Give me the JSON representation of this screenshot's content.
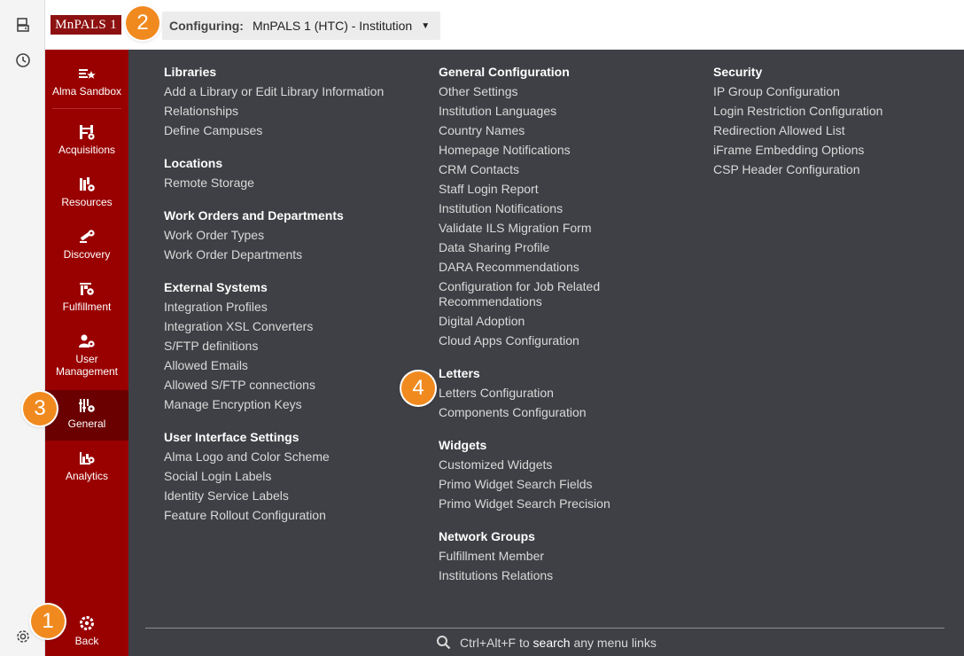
{
  "brand": {
    "logo_text": "MnPALS 1",
    "accent": "#990000",
    "logo_bg": "#8e1111"
  },
  "header": {
    "configuring_label": "Configuring:",
    "configuring_value": "MnPALS 1 (HTC) - Institution"
  },
  "rail": {
    "icons": [
      "server-icon",
      "history-icon",
      "settings-icon"
    ]
  },
  "badges": [
    "1",
    "2",
    "3",
    "4"
  ],
  "sidebar": {
    "items": [
      {
        "label": "Alma Sandbox",
        "icon": "sandbox-icon"
      },
      {
        "label": "Acquisitions",
        "icon": "acquisitions-icon"
      },
      {
        "label": "Resources",
        "icon": "resources-icon"
      },
      {
        "label": "Discovery",
        "icon": "discovery-icon"
      },
      {
        "label": "Fulfillment",
        "icon": "fulfillment-icon"
      },
      {
        "label": "User Management",
        "icon": "user-management-icon"
      },
      {
        "label": "General",
        "icon": "general-icon",
        "active": true
      },
      {
        "label": "Analytics",
        "icon": "analytics-icon"
      }
    ],
    "back_label": "Back"
  },
  "menu": {
    "col1": [
      {
        "heading": "Libraries",
        "links": [
          "Add a Library or Edit Library Information",
          "Relationships",
          "Define Campuses"
        ]
      },
      {
        "heading": "Locations",
        "links": [
          "Remote Storage"
        ]
      },
      {
        "heading": "Work Orders and Departments",
        "links": [
          "Work Order Types",
          "Work Order Departments"
        ]
      },
      {
        "heading": "External Systems",
        "links": [
          "Integration Profiles",
          "Integration XSL Converters",
          "S/FTP definitions",
          "Allowed Emails",
          "Allowed S/FTP connections",
          "Manage Encryption Keys"
        ]
      },
      {
        "heading": "User Interface Settings",
        "links": [
          "Alma Logo and Color Scheme",
          "Social Login Labels",
          "Identity Service Labels",
          "Feature Rollout Configuration"
        ]
      }
    ],
    "col2": [
      {
        "heading": "General Configuration",
        "links": [
          "Other Settings",
          "Institution Languages",
          "Country Names",
          "Homepage Notifications",
          "CRM Contacts",
          "Staff Login Report",
          "Institution Notifications",
          "Validate ILS Migration Form",
          "Data Sharing Profile",
          "DARA Recommendations",
          "Configuration for Job Related Recommendations",
          "Digital Adoption",
          "Cloud Apps Configuration"
        ]
      },
      {
        "heading": "Letters",
        "links": [
          "Letters Configuration",
          "Components Configuration"
        ]
      },
      {
        "heading": "Widgets",
        "links": [
          "Customized Widgets",
          "Primo Widget Search Fields",
          "Primo Widget Search Precision"
        ]
      },
      {
        "heading": "Network Groups",
        "links": [
          "Fulfillment Member",
          "Institutions Relations"
        ]
      }
    ],
    "col3": [
      {
        "heading": "Security",
        "links": [
          "IP Group Configuration",
          "Login Restriction Configuration",
          "Redirection Allowed List",
          "iFrame Embedding Options",
          "CSP Header Configuration"
        ]
      }
    ]
  },
  "search_hint": {
    "shortcut": "Ctrl+Alt+F",
    "to": "to",
    "search": "search",
    "rest": "any menu links"
  }
}
